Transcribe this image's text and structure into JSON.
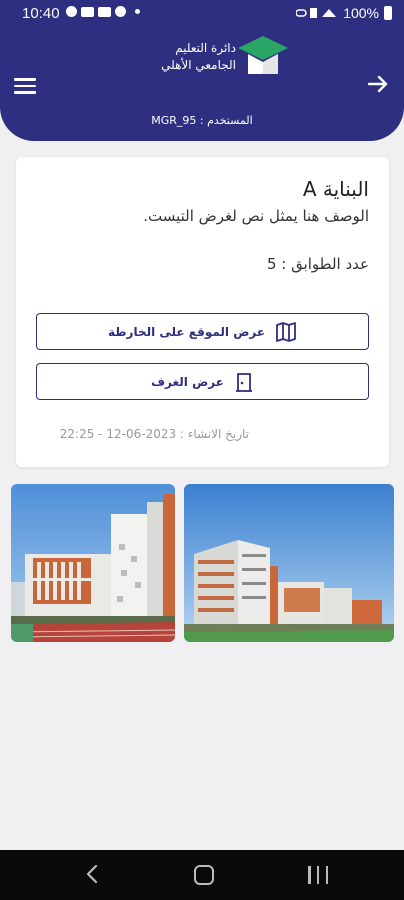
{
  "status_bar": {
    "time": "10:40",
    "battery": "100%"
  },
  "header": {
    "logo_line1": "دائرة التعليم",
    "logo_line2": "الجامعي الأهلي",
    "user_line": "المستخدم : MGR_95"
  },
  "building": {
    "title": "البناية A",
    "description": "الوصف هنا يمثل نص لغرض التيست.",
    "floors": "عدد الطوابق : 5",
    "map_button": "عرض الموقع على الخارطة",
    "rooms_button": "عرض الغرف",
    "created": "تاريخ الانشاء : 2023-06-12 - 22:25"
  },
  "colors": {
    "primary": "#2e2f80",
    "accent": "#2aa766",
    "background": "#f0f0f2"
  },
  "icons": {
    "menu": "menu-icon",
    "back": "arrow-right-icon",
    "map": "map-icon",
    "door": "door-icon"
  }
}
